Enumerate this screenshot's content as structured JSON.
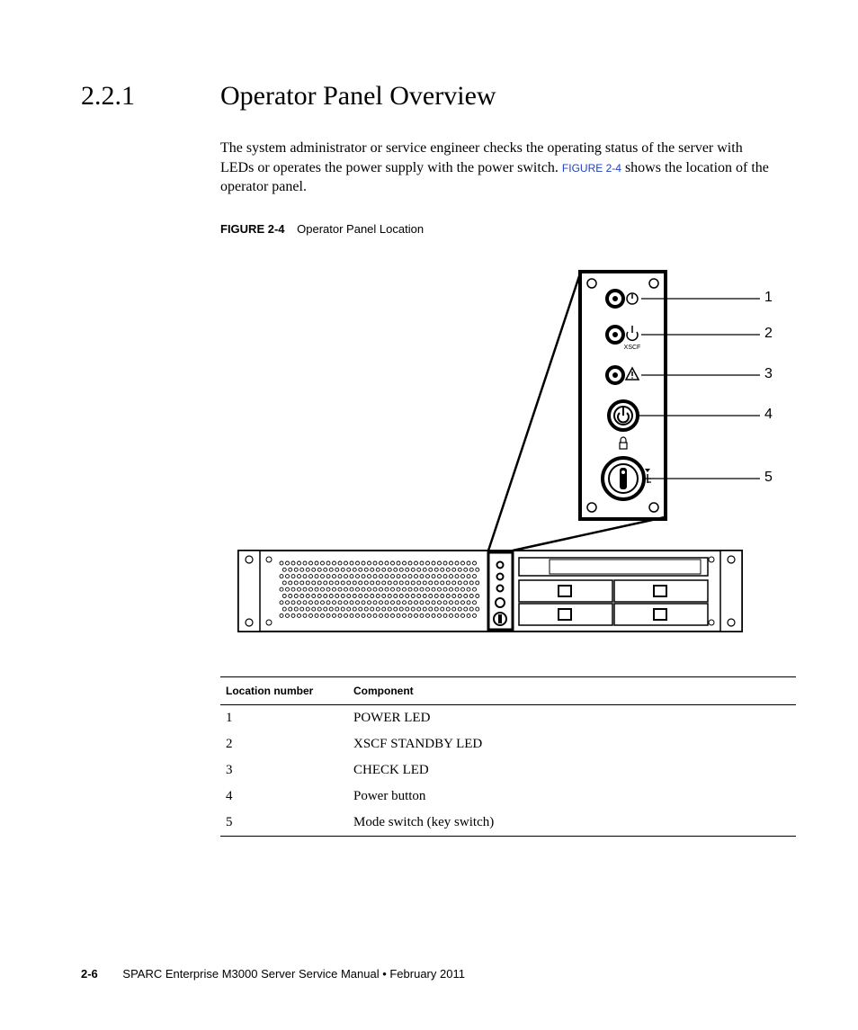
{
  "section": {
    "number": "2.2.1",
    "title": "Operator Panel Overview"
  },
  "paragraph": {
    "part1": "The system administrator or service engineer checks the operating status of the server with LEDs or operates the power supply with the power switch. ",
    "xref": "FIGURE 2-4",
    "part2": " shows the location of the operator panel."
  },
  "figure": {
    "label": "FIGURE 2-4",
    "title": "Operator Panel Location",
    "panel_label": "XSCF",
    "callouts": [
      "1",
      "2",
      "3",
      "4",
      "5"
    ]
  },
  "table": {
    "headers": [
      "Location number",
      "Component"
    ],
    "rows": [
      {
        "num": "1",
        "comp": "POWER LED"
      },
      {
        "num": "2",
        "comp": "XSCF STANDBY LED"
      },
      {
        "num": "3",
        "comp": "CHECK LED"
      },
      {
        "num": "4",
        "comp": "Power button"
      },
      {
        "num": "5",
        "comp": "Mode switch (key switch)"
      }
    ]
  },
  "footer": {
    "pageno": "2-6",
    "text": "SPARC Enterprise M3000 Server Service Manual  •  February 2011"
  }
}
